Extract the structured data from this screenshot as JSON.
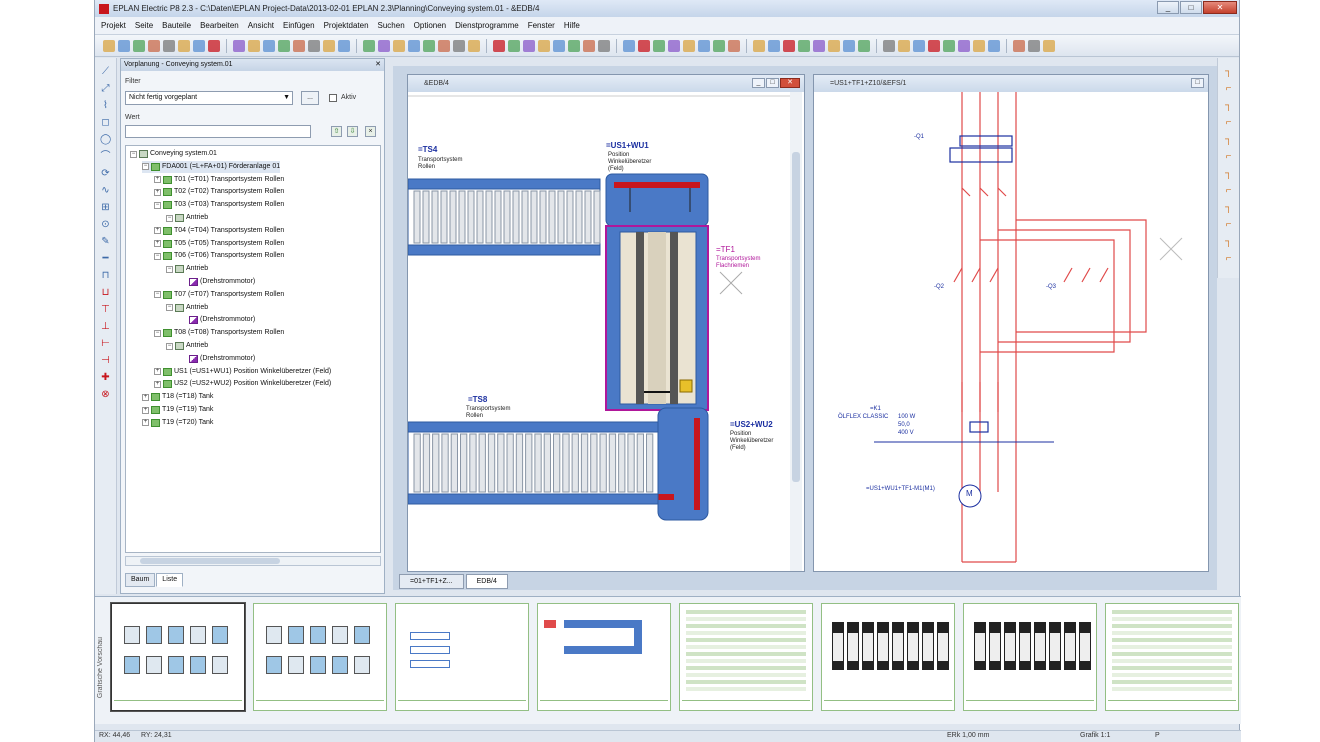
{
  "window": {
    "title": "EPLAN Electric P8 2.3 - C:\\Daten\\EPLAN Project-Data\\2013-02-01 EPLAN 2.3\\Planning\\Conveying system.01 - &EDB/4",
    "buttons": [
      "_",
      "□",
      "✕"
    ]
  },
  "menu": [
    "Projekt",
    "Seite",
    "Bauteile",
    "Bearbeiten",
    "Ansicht",
    "Einfügen",
    "Projektdaten",
    "Suchen",
    "Optionen",
    "Dienstprogramme",
    "Fenster",
    "Hilfe"
  ],
  "nav": {
    "title": "Vorplanung - Conveying system.01",
    "filter_label": "Filter",
    "filter_value": "Nicht fertig vorgeplant",
    "filter_button": "...",
    "aktiv_label": "Aktiv",
    "wert_label": "Wert",
    "tree": [
      {
        "indent": 0,
        "exp": "−",
        "icon": "grp",
        "text": "Conveying system.01"
      },
      {
        "indent": 1,
        "exp": "−",
        "icon": "fold",
        "text": "FDA001 (=L+FA+01) Förderanlage 01",
        "selected": true
      },
      {
        "indent": 2,
        "exp": "+",
        "icon": "fold",
        "text": "T01 (=T01) Transportsystem Rollen"
      },
      {
        "indent": 2,
        "exp": "+",
        "icon": "fold",
        "text": "T02 (=T02) Transportsystem Rollen"
      },
      {
        "indent": 2,
        "exp": "−",
        "icon": "fold",
        "text": "T03 (=T03) Transportsystem Rollen"
      },
      {
        "indent": 3,
        "exp": "−",
        "icon": "grp",
        "text": "Antrieb"
      },
      {
        "indent": 2,
        "exp": "+",
        "icon": "fold",
        "text": "T04 (=T04) Transportsystem Rollen"
      },
      {
        "indent": 2,
        "exp": "+",
        "icon": "fold",
        "text": "T05 (=T05) Transportsystem Rollen"
      },
      {
        "indent": 2,
        "exp": "−",
        "icon": "fold",
        "text": "T06 (=T06) Transportsystem Rollen"
      },
      {
        "indent": 3,
        "exp": "−",
        "icon": "grp",
        "text": "Antrieb"
      },
      {
        "indent": 4,
        "exp": "",
        "icon": "mot",
        "text": "(Drehstrommotor)"
      },
      {
        "indent": 2,
        "exp": "−",
        "icon": "fold",
        "text": "T07 (=T07) Transportsystem Rollen"
      },
      {
        "indent": 3,
        "exp": "−",
        "icon": "grp",
        "text": "Antrieb"
      },
      {
        "indent": 4,
        "exp": "",
        "icon": "mot",
        "text": "(Drehstrommotor)"
      },
      {
        "indent": 2,
        "exp": "−",
        "icon": "fold",
        "text": "T08 (=T08) Transportsystem Rollen"
      },
      {
        "indent": 3,
        "exp": "−",
        "icon": "grp",
        "text": "Antrieb"
      },
      {
        "indent": 4,
        "exp": "",
        "icon": "mot",
        "text": "(Drehstrommotor)"
      },
      {
        "indent": 2,
        "exp": "+",
        "icon": "fold",
        "text": "US1 (=US1+WU1) Position Winkelüberetzer (Feld)"
      },
      {
        "indent": 2,
        "exp": "+",
        "icon": "fold",
        "text": "US2 (=US2+WU2) Position Winkelüberetzer (Feld)"
      },
      {
        "indent": 1,
        "exp": "+",
        "icon": "fold",
        "text": "T18 (=T18) Tank"
      },
      {
        "indent": 1,
        "exp": "+",
        "icon": "fold",
        "text": "T19 (=T19) Tank"
      },
      {
        "indent": 1,
        "exp": "+",
        "icon": "fold",
        "text": "T19 (=T20) Tank"
      }
    ],
    "tabs": [
      "Baum",
      "Liste"
    ]
  },
  "layout_window": {
    "title": "&EDB/4",
    "labels": {
      "ts4": "=TS4",
      "ts4_sub1": "Transportsystem",
      "ts4_sub2": "Rollen",
      "us1": "=US1+WU1",
      "us1_sub1": "Position",
      "us1_sub2": "Winkelüberetzer",
      "us1_sub3": "(Feld)",
      "tf1": "=TF1",
      "tf1_sub1": "Transportsystem",
      "tf1_sub2": "Flachriemen",
      "ts8": "=TS8",
      "ts8_sub1": "Transportsystem",
      "ts8_sub2": "Rollen",
      "us2": "=US2+WU2",
      "us2_sub1": "Position",
      "us2_sub2": "Winkelüberetzer",
      "us2_sub3": "(Feld)"
    }
  },
  "schematic_window": {
    "title": "=US1+TF1+Z10/&EFS/1",
    "labels": {
      "q1": "-Q1",
      "q2": "-Q2",
      "q3": "-Q3",
      "spec1": "=K1",
      "motor_type": "ÖLFLEX CLASSIC",
      "motor_p": "100 W",
      "motor_f": "50,0",
      "motor_v": "400 V",
      "motor_letter": "M",
      "motor_ref": "=US1+WU1+TF1-M1(M1)"
    }
  },
  "doc_tabs": [
    "=01+TF1+Z...",
    "EDB/4"
  ],
  "preview_label": "Grafische Vorschau",
  "status": {
    "rx": "RX: 44,46",
    "ry": "RY: 24,31",
    "grid": "ERk 1,00 mm",
    "grafik": "Grafik 1:1",
    "p": "P"
  },
  "colors": {
    "brand": "#c8161d",
    "conveyor_blue": "#4a79c6",
    "schematic_red": "#e04a4a",
    "label_blue": "#1b2fa0",
    "label_magenta": "#b0179a"
  }
}
